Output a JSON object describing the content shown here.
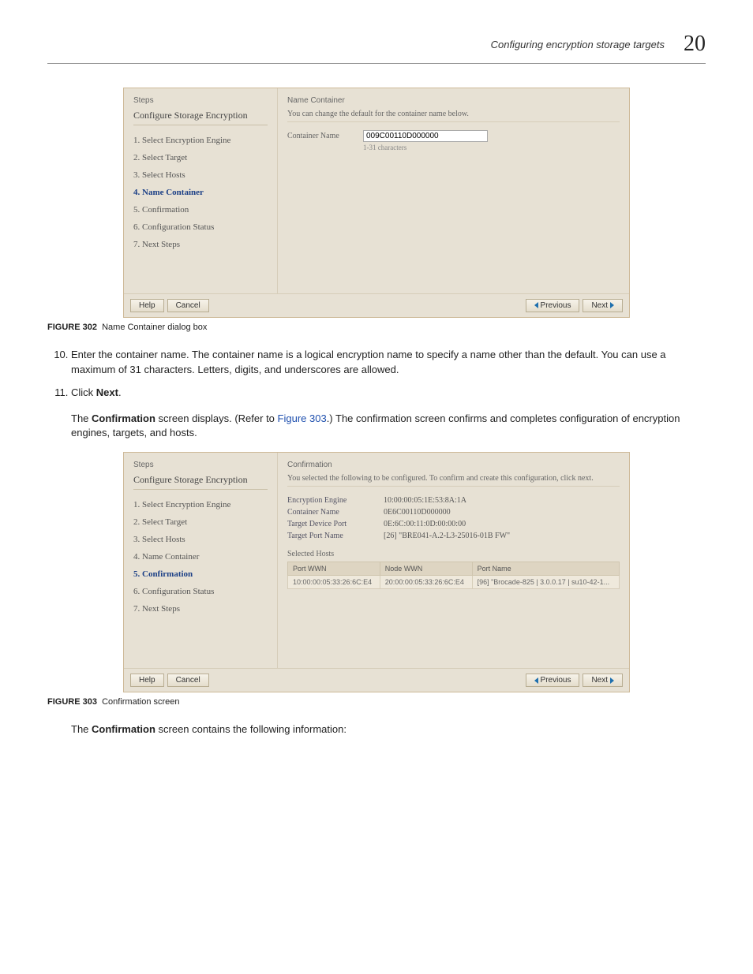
{
  "header": {
    "title": "Configuring encryption storage targets",
    "chapter": "20"
  },
  "dialog1": {
    "steps_hdr": "Steps",
    "wizard_title": "Configure Storage Encryption",
    "steps": [
      "1. Select Encryption Engine",
      "2. Select Target",
      "3. Select Hosts",
      "4. Name Container",
      "5. Confirmation",
      "6. Configuration Status",
      "7. Next Steps"
    ],
    "active_index": 3,
    "panel_hdr": "Name Container",
    "panel_desc": "You can change the default for the container name below.",
    "field_label": "Container Name",
    "field_value": "009C00110D000000",
    "hint": "1-31 characters",
    "buttons": {
      "help": "Help",
      "cancel": "Cancel",
      "previous": "Previous",
      "next": "Next"
    }
  },
  "fig302": {
    "label": "FIGURE 302",
    "caption": "Name Container dialog box"
  },
  "step10": "Enter the container name. The container name is a logical encryption name to specify a name other than the default. You can use a maximum of 31 characters. Letters, digits, and underscores are allowed.",
  "step11_a": "Click ",
  "step11_b": "Next",
  "step11_c": ".",
  "para1_a": "The ",
  "para1_b": "Confirmation",
  "para1_c": " screen displays. (Refer to ",
  "para1_link": "Figure 303",
  "para1_d": ".) The confirmation screen confirms and completes configuration of encryption engines, targets, and hosts.",
  "dialog2": {
    "steps_hdr": "Steps",
    "wizard_title": "Configure Storage Encryption",
    "steps": [
      "1. Select Encryption Engine",
      "2. Select Target",
      "3. Select Hosts",
      "4. Name Container",
      "5. Confirmation",
      "6. Configuration Status",
      "7. Next Steps"
    ],
    "active_index": 4,
    "panel_hdr": "Confirmation",
    "panel_desc": "You selected the following to be configured. To confirm and create this configuration, click next.",
    "kv": [
      {
        "k": "Encryption Engine",
        "v": "10:00:00:05:1E:53:8A:1A"
      },
      {
        "k": "Container Name",
        "v": "0E6C00110D000000"
      },
      {
        "k": "Target Device Port",
        "v": "0E:6C:00:11:0D:00:00:00"
      },
      {
        "k": "Target Port Name",
        "v": "[26] \"BRE041-A.2-L3-25016-01B FW\""
      }
    ],
    "hosts_label": "Selected Hosts",
    "hosts": {
      "headers": [
        "Port WWN",
        "Node WWN",
        "Port Name"
      ],
      "rows": [
        [
          "10:00:00:05:33:26:6C:E4",
          "20:00:00:05:33:26:6C:E4",
          "[96] \"Brocade-825 | 3.0.0.17 | su10-42-1..."
        ]
      ]
    },
    "buttons": {
      "help": "Help",
      "cancel": "Cancel",
      "previous": "Previous",
      "next": "Next"
    }
  },
  "fig303": {
    "label": "FIGURE 303",
    "caption": "Confirmation screen"
  },
  "para2_a": "The ",
  "para2_b": "Confirmation",
  "para2_c": " screen contains the following information:"
}
